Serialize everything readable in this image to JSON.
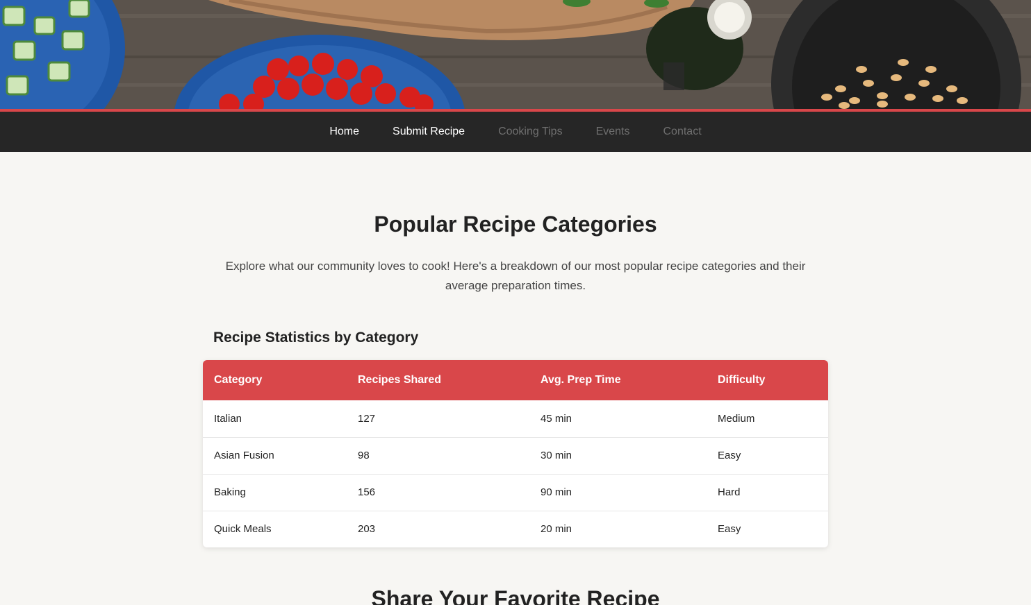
{
  "hero": {
    "image": "hero-food-photo"
  },
  "nav": {
    "items": [
      {
        "label": "Home",
        "state": "active"
      },
      {
        "label": "Submit Recipe",
        "state": "active"
      },
      {
        "label": "Cooking Tips",
        "state": "muted"
      },
      {
        "label": "Events",
        "state": "muted"
      },
      {
        "label": "Contact",
        "state": "muted"
      }
    ]
  },
  "main": {
    "title": "Popular Recipe Categories",
    "intro": "Explore what our community loves to cook! Here's a breakdown of our most popular recipe categories and their average preparation times.",
    "table_title": "Recipe Statistics by Category",
    "table": {
      "headers": [
        "Category",
        "Recipes Shared",
        "Avg. Prep Time",
        "Difficulty"
      ],
      "rows": [
        [
          "Italian",
          "127",
          "45 min",
          "Medium"
        ],
        [
          "Asian Fusion",
          "98",
          "30 min",
          "Easy"
        ],
        [
          "Baking",
          "156",
          "90 min",
          "Hard"
        ],
        [
          "Quick Meals",
          "203",
          "20 min",
          "Easy"
        ]
      ]
    },
    "share_title": "Share Your Favorite Recipe"
  },
  "colors": {
    "accent": "#d9474a",
    "nav_bg": "#262626",
    "page_bg": "#f7f6f3"
  }
}
